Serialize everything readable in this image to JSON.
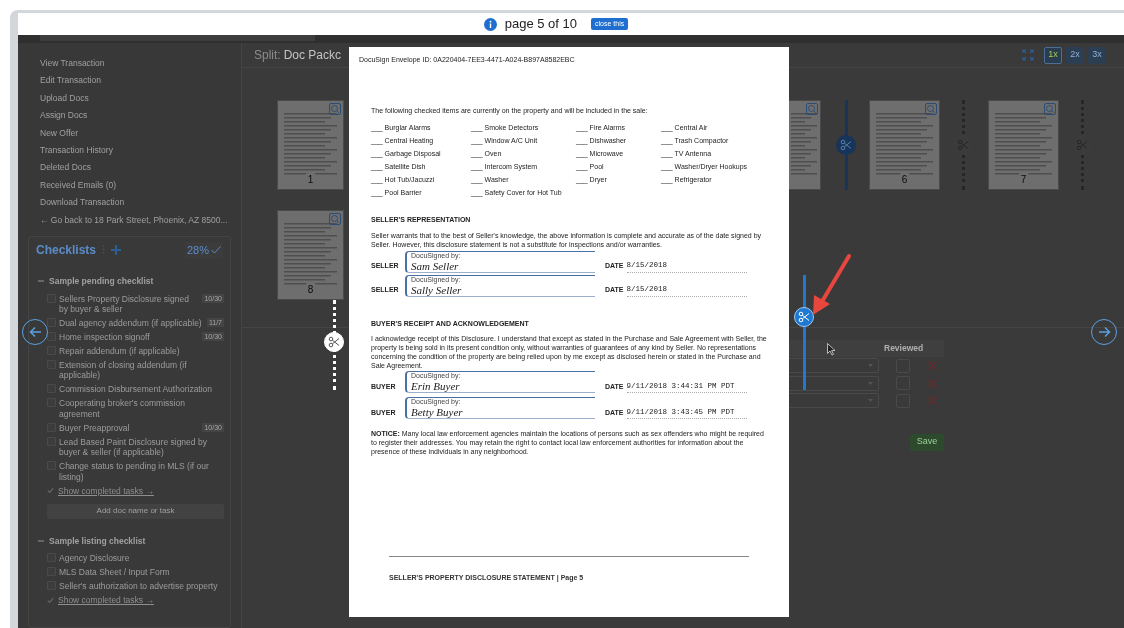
{
  "viewer": {
    "page_indicator": "page 5 of 10",
    "close_button": "close this"
  },
  "sidebar": {
    "links": [
      "View Transaction",
      "Edit Transaction",
      "Upload Docs",
      "Assign Docs",
      "New Offer",
      "Transaction History",
      "Deleted Docs",
      "Received Emails (0)",
      "Download Transaction",
      "← Go back to 18 Park Street, Phoenix, AZ 8500..."
    ],
    "checklists": {
      "title": "Checklists",
      "percent": "28%",
      "groups": [
        {
          "name": "Sample pending checklist",
          "expanded": true,
          "items": [
            {
              "label": "Sellers Property Disclosure signed by buyer & seller",
              "checked": false,
              "count": "10/30"
            },
            {
              "label": "Dual agency addendum (if applicable)",
              "checked": false,
              "count": "11/7"
            },
            {
              "label": "Home inspection signoff",
              "checked": false,
              "count": "10/30"
            },
            {
              "label": "Repair addendum (if applicable)",
              "checked": false
            },
            {
              "label": "Extension of closing addendum (if applicable)",
              "checked": false
            },
            {
              "label": "Commission Disbursement Authorization",
              "checked": false
            },
            {
              "label": "Cooperating broker's commission agreement",
              "checked": false
            },
            {
              "label": "Buyer Preapproval",
              "checked": false,
              "count": "10/30"
            },
            {
              "label": "Lead Based Paint Disclosure signed by buyer & seller (if applicable)",
              "checked": false
            },
            {
              "label": "Change status to pending in MLS (if our listing)",
              "checked": false
            }
          ],
          "show_completed": "Show completed tasks →",
          "add_task": "Add doc name or task"
        },
        {
          "name": "Sample listing checklist",
          "expanded": true,
          "items": [
            {
              "label": "Agency Disclosure",
              "checked": false
            },
            {
              "label": "MLS Data Sheet / Input Form",
              "checked": false
            },
            {
              "label": "Seller's authorization to advertise property",
              "checked": false
            }
          ],
          "show_completed": "Show completed tasks →"
        }
      ]
    }
  },
  "split_view": {
    "title_prefix": "Split:",
    "title": "Doc Packc",
    "zoom_options": [
      {
        "label": "1x",
        "selected": true
      },
      {
        "label": "2x",
        "selected": false
      },
      {
        "label": "3x",
        "selected": false
      }
    ],
    "left_pages": [
      {
        "number": "1"
      },
      {
        "number": "8"
      }
    ],
    "right_strip": [
      {
        "kind": "page"
      },
      {
        "kind": "split",
        "selected": true
      },
      {
        "kind": "page",
        "number": "6"
      },
      {
        "kind": "split",
        "selected": false
      },
      {
        "kind": "page",
        "number": "7"
      },
      {
        "kind": "split",
        "selected": false
      }
    ],
    "split_before_preview": {
      "selected": false
    },
    "split_after_preview": {
      "selected": true
    },
    "table": {
      "columns": [
        "Reviewed"
      ],
      "rows": [
        {
          "reviewed": false
        },
        {
          "reviewed": false
        },
        {
          "reviewed": false
        }
      ]
    },
    "save_button": "Save"
  },
  "document": {
    "header": "DocuSign Envelope ID: 0A220404-7EE3-4471-A024-B897A8582EBC",
    "intro": "The following checked items are currently on the property and will be included in the sale:",
    "items": [
      [
        "___ Burglar Alarms",
        "___ Smoke Detectors",
        "___ Fire Alarms",
        "___ Central Air"
      ],
      [
        "___ Central Heating",
        "___ Window A/C Unit",
        "___ Dishwasher",
        "___ Trash Compactor"
      ],
      [
        "___ Garbage Disposal",
        "___ Oven",
        "___ Microwave",
        "___ TV Antenna"
      ],
      [
        "___ Satellite Dish",
        "___ Intercom System",
        "___ Pool",
        "___ Washer/Dryer Hookups"
      ],
      [
        "___ Hot Tub/Jacuzzi",
        "___ Washer",
        "___ Dryer",
        "___ Refrigerator"
      ],
      [
        "___ Pool Barrier",
        "___ Safety Cover for Hot Tub"
      ]
    ],
    "seller_heading": "SELLER'S REPRESENTATION",
    "seller_text": "Seller warrants that to the best of Seller's knowledge, the above information is complete and accurate as of the date signed by Seller. However, this disclosure statement is not a substitute for inspections and/or warranties.",
    "seller_signatures": [
      {
        "role": "SELLER",
        "signed_by": "DocuSigned by:",
        "signature": "Sam Seller",
        "date_label": "DATE",
        "date": "8/15/2018"
      },
      {
        "role": "SELLER",
        "signed_by": "DocuSigned by:",
        "signature": "Sally Seller",
        "date_label": "DATE",
        "date": "8/15/2018"
      }
    ],
    "buyer_heading": "BUYER'S RECEIPT AND ACKNOWLEDGEMENT",
    "buyer_text": "I acknowledge receipt of this Disclosure. I understand that except as stated in the Purchase and Sale Agreement with Seller, the property is being sold in its present condition only, without warranties of guarantees of any kind by Seller. No representations concerning the condition of the property are being relied upon by me except as disclosed herein or stated in the Purchase and Sale Agreement.",
    "buyer_signatures": [
      {
        "role": "BUYER",
        "signed_by": "DocuSigned by:",
        "signature": "Erin Buyer",
        "date_label": "DATE",
        "date": "9/11/2018 3:44:31 PM PDT"
      },
      {
        "role": "BUYER",
        "signed_by": "DocuSigned by:",
        "signature": "Betty Buyer",
        "date_label": "DATE",
        "date": "9/11/2018 3:43:45 PM PDT"
      }
    ],
    "notice": "**NOTICE:** Many local law enforcement agencies maintain the locations of persons such as sex offenders who might be required to register their addresses. You may retain the right to contact local law enforcement authorities for information about the presence of these individuals in any neighborhood.",
    "footer": "SELLER'S PROPERTY DISCLOSURE STATEMENT | Page 5"
  }
}
